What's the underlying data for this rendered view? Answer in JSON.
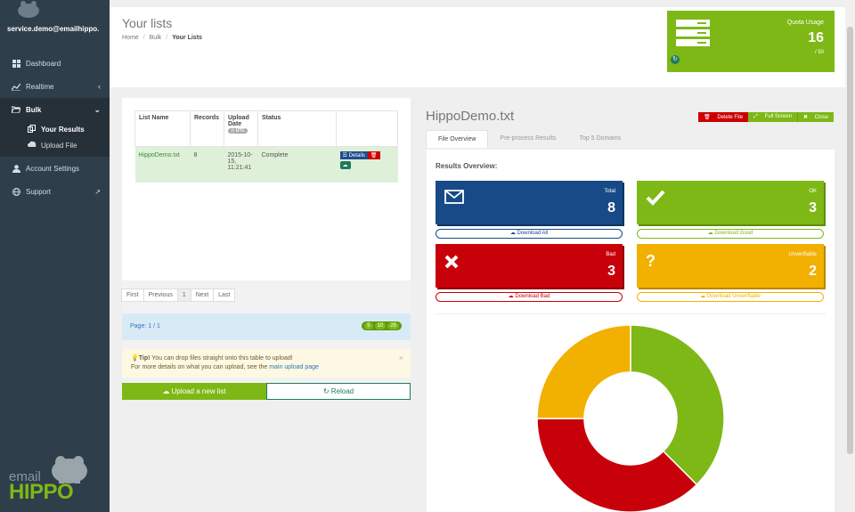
{
  "sidebar": {
    "user": "service.demo@emailhippo.",
    "items": [
      {
        "label": "Dashboard",
        "icon": "dashboard-icon"
      },
      {
        "label": "Realtime",
        "icon": "chart-line-icon"
      },
      {
        "label": "Bulk",
        "icon": "folder-open-icon"
      },
      {
        "label": "Account Settings",
        "icon": "user-icon"
      },
      {
        "label": "Support",
        "icon": "globe-icon"
      }
    ],
    "bulk_sub": [
      {
        "label": "Your Results",
        "icon": "copy-icon"
      },
      {
        "label": "Upload File",
        "icon": "cloud-upload-icon"
      }
    ],
    "logo_text_top": "email",
    "logo_text_bottom": "HIPPO"
  },
  "header": {
    "title": "Your lists",
    "breadcrumb": [
      "Home",
      "Bulk",
      "Your Lists"
    ]
  },
  "quota": {
    "label": "Quota Usage",
    "value": "16",
    "max": "/ 50"
  },
  "table": {
    "headers": [
      "List Name",
      "Records",
      "Upload Date",
      "Status",
      ""
    ],
    "utc_badge": "UTC",
    "row": {
      "name": "HippoDemo.txt",
      "records": "8",
      "date": "2015-10-15, 11:21:41",
      "status": "Complete",
      "details_label": "Details"
    }
  },
  "pager": [
    "First",
    "Previous",
    "1",
    "Next",
    "Last"
  ],
  "page_info": "Page: 1 / 1",
  "page_sizes": [
    "5",
    "10",
    "25"
  ],
  "tip": {
    "strong": "Tip!",
    "text1": " You can drop files straight onto this table to upload!",
    "text2": "For more details on what you can upload, see the ",
    "link": "main upload page"
  },
  "buttons": {
    "upload": "Upload a new list",
    "reload": "Reload"
  },
  "file": {
    "title": "HippoDemo.txt",
    "delete": "Delete File",
    "fullscreen": "Full Screen",
    "close": "Close"
  },
  "tabs": [
    "File Overview",
    "Pre-process Results",
    "Top 5 Domains"
  ],
  "results": {
    "heading": "Results Overview:",
    "total_label": "Total",
    "total_value": "8",
    "ok_label": "OK",
    "ok_value": "3",
    "bad_label": "Bad",
    "bad_value": "3",
    "unv_label": "Unverifiable",
    "unv_value": "2",
    "dl_all": "Download All",
    "dl_good": "Download Good",
    "dl_bad": "Download Bad",
    "dl_unv": "Download Unverifiable"
  },
  "colors": {
    "ok": "#7eb816",
    "bad": "#c80009",
    "unverifiable": "#f2b000",
    "total": "#174a86"
  },
  "chart_data": {
    "type": "pie",
    "categories": [
      "OK",
      "Bad",
      "Unverifiable"
    ],
    "values": [
      3,
      3,
      2
    ],
    "colors": [
      "#7eb816",
      "#c80009",
      "#f2b000"
    ]
  }
}
